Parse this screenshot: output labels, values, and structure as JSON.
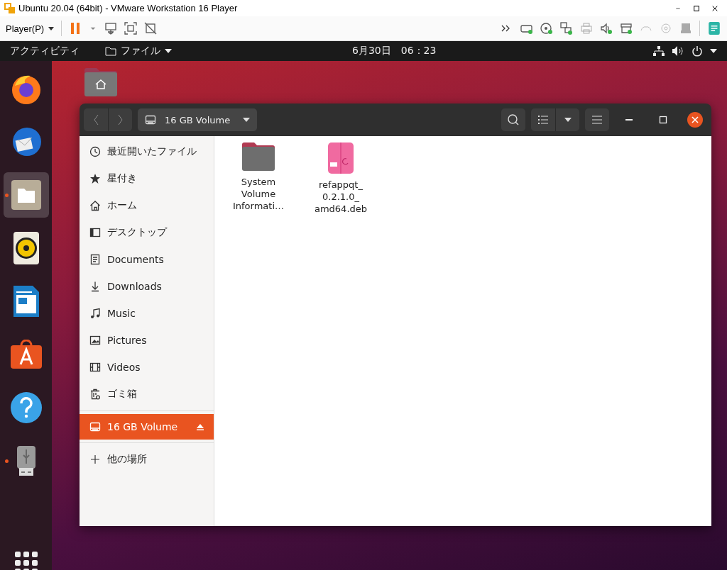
{
  "window": {
    "title": "Ubuntu 20.04 (64bit) - VMware Workstation 16 Player"
  },
  "player_toolbar": {
    "menu": "Player(P)"
  },
  "top_bar": {
    "activities": "アクティビティ",
    "app_menu": "ファイル",
    "clock": "6月30日　06：23"
  },
  "dock": {
    "items": [
      {
        "kind": "firefox",
        "running": false,
        "selected": false
      },
      {
        "kind": "thunderbird",
        "running": false,
        "selected": false
      },
      {
        "kind": "files",
        "running": true,
        "selected": true
      },
      {
        "kind": "rhythmbox",
        "running": false,
        "selected": false
      },
      {
        "kind": "writer",
        "running": false,
        "selected": false
      },
      {
        "kind": "software",
        "running": false,
        "selected": false
      },
      {
        "kind": "help",
        "running": false,
        "selected": false
      },
      {
        "kind": "usb",
        "running": true,
        "selected": false
      }
    ]
  },
  "file_manager": {
    "location": "16 GB Volume",
    "sidebar": {
      "places": [
        {
          "kind": "recent",
          "label": "最近開いたファイル",
          "selected": false
        },
        {
          "kind": "starred",
          "label": "星付き",
          "selected": false
        },
        {
          "kind": "home",
          "label": "ホーム",
          "selected": false
        },
        {
          "kind": "desktop",
          "label": "デスクトップ",
          "selected": false
        },
        {
          "kind": "documents",
          "label": "Documents",
          "selected": false
        },
        {
          "kind": "downloads",
          "label": "Downloads",
          "selected": false
        },
        {
          "kind": "music",
          "label": "Music",
          "selected": false
        },
        {
          "kind": "pictures",
          "label": "Pictures",
          "selected": false
        },
        {
          "kind": "videos",
          "label": "Videos",
          "selected": false
        },
        {
          "kind": "trash",
          "label": "ゴミ箱",
          "selected": false
        }
      ],
      "devices": [
        {
          "kind": "drive",
          "label": "16 GB Volume",
          "selected": true
        }
      ],
      "other": {
        "label": "他の場所"
      }
    },
    "files": [
      {
        "kind": "folder",
        "lines": [
          "System",
          "Volume",
          "Informati…"
        ]
      },
      {
        "kind": "deb",
        "lines": [
          "refappqt_",
          "0.2.1.0_",
          "amd64.deb"
        ]
      }
    ]
  }
}
